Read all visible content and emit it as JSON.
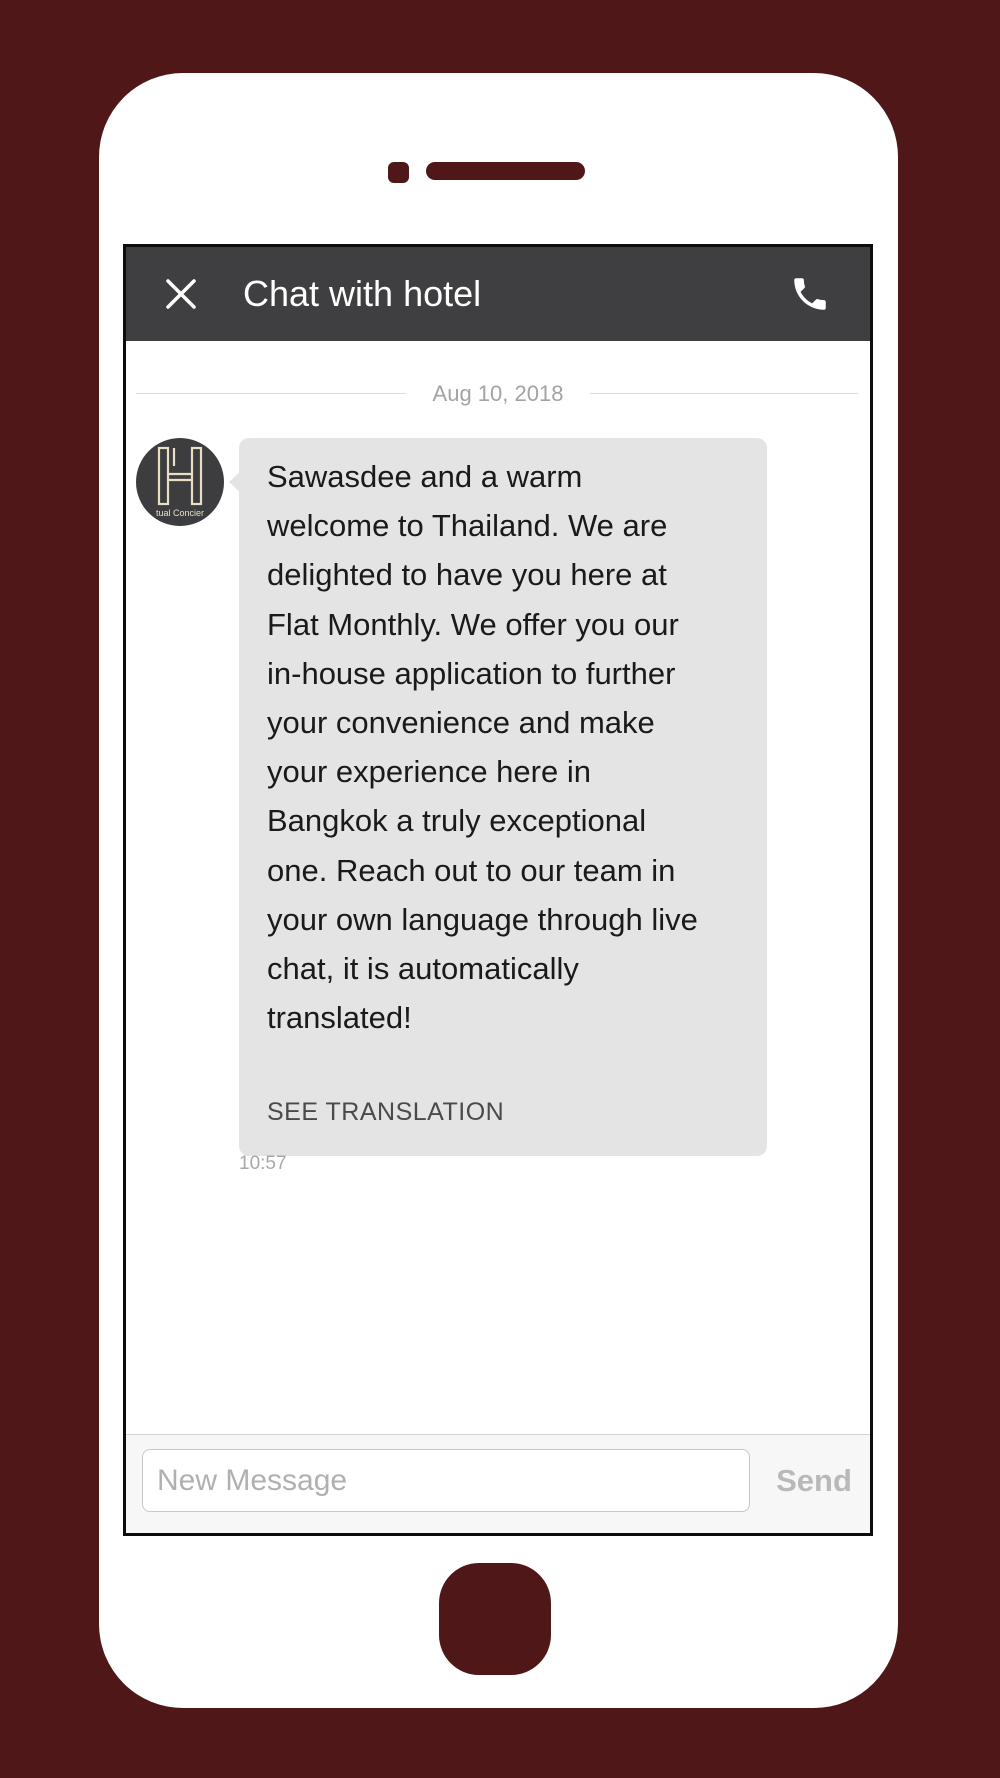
{
  "header": {
    "title": "Chat with hotel",
    "close_icon": "close-icon",
    "call_icon": "phone-icon"
  },
  "conversation": {
    "date": "Aug 10, 2018",
    "messages": [
      {
        "sender_avatar": "hotel-logo",
        "avatar_caption": "tual Concier",
        "text": "Sawasdee and a warm\nwelcome to Thailand. We are\ndelighted to have you here at\nFlat Monthly. We offer you our\nin-house application to further\nyour convenience and make\nyour experience here in\nBangkok a truly exceptional\none. Reach out to our team in\nyour own language through live\nchat, it is automatically\ntranslated!",
        "action": "SEE TRANSLATION",
        "time": "10:57"
      }
    ]
  },
  "composer": {
    "placeholder": "New Message",
    "value": "",
    "send_label": "Send"
  },
  "colors": {
    "background": "#4f1718",
    "header": "#3f3f41",
    "bubble": "#e4e4e4"
  }
}
